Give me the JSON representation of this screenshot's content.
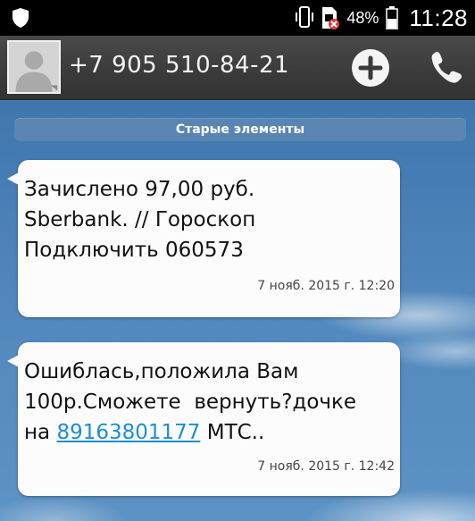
{
  "status_bar": {
    "battery_percent": "48%",
    "time": "11:28"
  },
  "header": {
    "contact_number": "+7 905 510-84-21"
  },
  "conversation": {
    "older_items_label": "Старые элементы",
    "messages": [
      {
        "text_lines": [
          "Зачислено 97,00 руб.",
          "Sberbank. // Гороскоп",
          "Подключить 060573"
        ],
        "timestamp": "7 нояб. 2015 г. 12:20"
      },
      {
        "text_line1": "Ошиблась,положила Вам",
        "text_line2": "100р.Сможете  вернуть?дочке",
        "text_line3_prefix": "на ",
        "phone_link": "89163801177",
        "text_line3_suffix": " МТС..",
        "timestamp": "7 нояб. 2015 г. 12:42"
      }
    ]
  },
  "colors": {
    "link": "#1b8ed8",
    "bubble": "#fcfcfc",
    "background": "#4b7fb4"
  }
}
